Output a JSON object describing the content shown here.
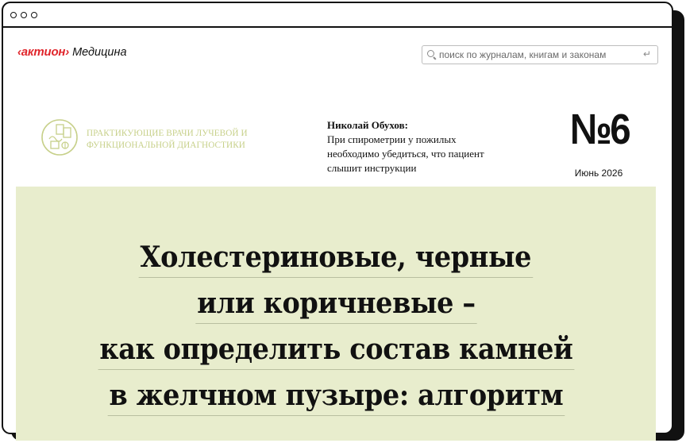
{
  "header": {
    "logo_brand": "‹актион›",
    "logo_product": "Медицина",
    "search_placeholder": "поиск по журналам, книгам и законам"
  },
  "journal": {
    "name_line_1": "ПРАКТИКУЮЩИЕ ВРАЧИ ЛУЧЕВОЙ И",
    "name_line_2": "ФУНКЦИОНАЛЬНОЙ ДИАГНОСТИКИ",
    "accent_color": "#c7d08a"
  },
  "teaser": {
    "author": "Николай Обухов:",
    "line_1": "При спирометрии у пожилых",
    "line_2": "необходимо убедиться, что пациент",
    "line_3": "слышит инструкции"
  },
  "issue": {
    "number": "№6",
    "date": "Июнь 2026"
  },
  "cover": {
    "background": "#e8edcd",
    "headline_lines": [
      "Холестериновые, черные",
      "или коричневые –",
      "как определить состав камней",
      "в желчном пузыре: алгоритм"
    ]
  },
  "colors": {
    "brand_red": "#e0262c",
    "text": "#111111"
  }
}
